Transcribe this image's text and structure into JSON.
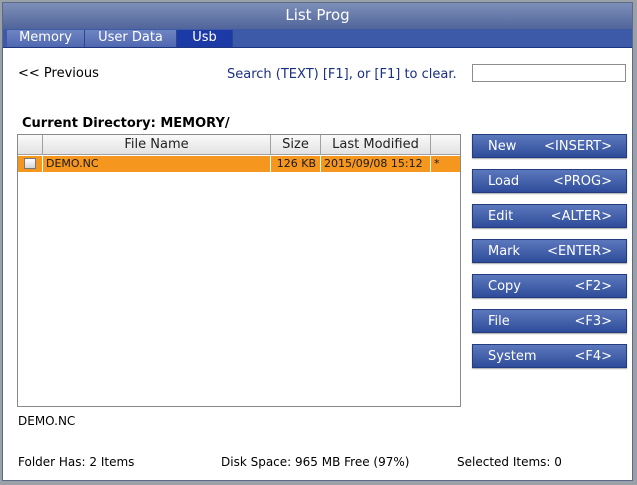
{
  "window": {
    "title": "List Prog"
  },
  "tabs": [
    "Memory",
    "User Data",
    "Usb"
  ],
  "nav": {
    "previous_label": "<< Previous"
  },
  "search": {
    "hint": "Search (TEXT) [F1], or [F1] to clear.",
    "value": ""
  },
  "directory": {
    "label": "Current Directory: MEMORY/"
  },
  "table": {
    "columns": [
      "File Name",
      "Size",
      "Last Modified"
    ],
    "rows": [
      {
        "name": "DEMO.NC",
        "size": "126 KB",
        "modified": "2015/09/08 15:12",
        "flag": "*",
        "checked": false
      }
    ]
  },
  "buttons": [
    {
      "label": "New",
      "key": "<INSERT>"
    },
    {
      "label": "Load",
      "key": "<PROG>"
    },
    {
      "label": "Edit",
      "key": "<ALTER>"
    },
    {
      "label": "Mark",
      "key": "<ENTER>"
    },
    {
      "label": "Copy",
      "key": "<F2>"
    },
    {
      "label": "File",
      "key": "<F3>"
    },
    {
      "label": "System",
      "key": "<F4>"
    }
  ],
  "selected_file": "DEMO.NC",
  "status": {
    "folder": "Folder Has: 2 Items",
    "disk": "Disk Space: 965 MB Free (97%)",
    "selected": "Selected Items: 0"
  },
  "colors": {
    "title_bar": "#5c6fa3",
    "tab_active": "#1c3aa6",
    "tab_strip": "#3d5aa8",
    "row_highlight": "#f5961e",
    "button": "#3d5aa8",
    "search_hint_text": "#1a2f84"
  }
}
